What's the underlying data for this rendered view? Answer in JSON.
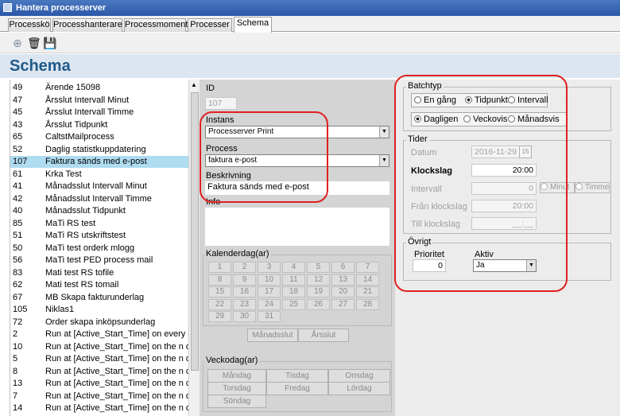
{
  "window": {
    "title": "Hantera processerver"
  },
  "tabs": [
    "Processkö",
    "Processhanterare",
    "Processmoment",
    "Processer",
    "Schema"
  ],
  "page_title": "Schema",
  "list": [
    {
      "id": "49",
      "name": "Ärende 15098"
    },
    {
      "id": "47",
      "name": "Årsslut Intervall Minut"
    },
    {
      "id": "45",
      "name": "Årsslut Intervall Timme"
    },
    {
      "id": "43",
      "name": "Årsslut Tidpunkt"
    },
    {
      "id": "65",
      "name": "CaltstMailprocess"
    },
    {
      "id": "52",
      "name": "Daglig statistkuppdatering"
    },
    {
      "id": "107",
      "name": "Faktura sänds med e-post"
    },
    {
      "id": "61",
      "name": "Krka Test"
    },
    {
      "id": "41",
      "name": "Månadsslut Intervall Minut"
    },
    {
      "id": "42",
      "name": "Månadsslut Intervall Timme"
    },
    {
      "id": "40",
      "name": "Månadsslut Tidpunkt"
    },
    {
      "id": "85",
      "name": "MaTi RS test"
    },
    {
      "id": "51",
      "name": "MaTi RS utskriftstest"
    },
    {
      "id": "50",
      "name": "MaTi test orderk mlogg"
    },
    {
      "id": "56",
      "name": "MaTi test PED process mail"
    },
    {
      "id": "83",
      "name": "Mati test RS tofile"
    },
    {
      "id": "62",
      "name": "Mati test RS tomail"
    },
    {
      "id": "67",
      "name": "MB Skapa fakturunderlag"
    },
    {
      "id": "105",
      "name": "Niklas1"
    },
    {
      "id": "72",
      "name": "Order skapa inköpsunderlag"
    },
    {
      "id": "2",
      "name": "Run at [Active_Start_Time] on every day"
    },
    {
      "id": "10",
      "name": "Run at [Active_Start_Time] on the n day in mo"
    },
    {
      "id": "5",
      "name": "Run at [Active_Start_Time] on the n day in we"
    },
    {
      "id": "8",
      "name": "Run at [Active_Start_Time] on the n day in we"
    },
    {
      "id": "13",
      "name": "Run at [Active_Start_Time] on the n days in in"
    },
    {
      "id": "7",
      "name": "Run at [Active_Start_Time] on the n days in in"
    },
    {
      "id": "14",
      "name": "Run at [Active_Start_Time] on the n days in we"
    },
    {
      "id": "11",
      "name": "Run at [Active_Start_Time] on the n days in we"
    }
  ],
  "selected_index": 6,
  "form": {
    "id_label": "ID",
    "id_value": "107",
    "instans_label": "Instans",
    "instans_value": "Processerver Print",
    "process_label": "Process",
    "process_value": "faktura e-post",
    "beskrivning_label": "Beskrivning",
    "beskrivning_value": "Faktura sänds med e-post",
    "info_label": "Info"
  },
  "kalender": {
    "label": "Kalenderdag(ar)",
    "days": [
      "1",
      "2",
      "3",
      "4",
      "5",
      "6",
      "7",
      "8",
      "9",
      "10",
      "11",
      "12",
      "13",
      "14",
      "15",
      "16",
      "17",
      "18",
      "19",
      "20",
      "21",
      "22",
      "23",
      "24",
      "25",
      "26",
      "27",
      "28",
      "29",
      "30",
      "31"
    ],
    "manadsslut": "Månadsslut",
    "arsslut": "Årsslut"
  },
  "veckodag": {
    "label": "Veckodag(ar)",
    "days": [
      "Måndag",
      "Tisdag",
      "Onsdag",
      "Torsdag",
      "Fredag",
      "Lördag",
      "Söndag"
    ]
  },
  "batchtyp": {
    "label": "Batchtyp",
    "types": [
      "En gång",
      "Tidpunkt",
      "Intervall"
    ],
    "type_selected": 1,
    "freq": [
      "Dagligen",
      "Veckovis",
      "Månadsvis"
    ],
    "freq_selected": 0
  },
  "tider": {
    "label": "Tider",
    "datum_label": "Datum",
    "datum_value": "2016-11-29",
    "klockslag_label": "Klockslag",
    "klockslag_value": "20:00",
    "intervall_label": "Intervall",
    "intervall_value": "0",
    "minut_label": "Minut",
    "timme_label": "Timme",
    "fran_label": "Från klockslag",
    "fran_value": "20:00",
    "till_label": "Till klockslag",
    "till_value": "__:__"
  },
  "ovrigt": {
    "label": "Övrigt",
    "prioritet_label": "Prioritet",
    "prioritet_value": "0",
    "aktiv_label": "Aktiv",
    "aktiv_value": "Ja"
  },
  "colors": {
    "title": "#1f5a8a",
    "selected_row": "#aedcf0",
    "highlight": "#e02020"
  }
}
